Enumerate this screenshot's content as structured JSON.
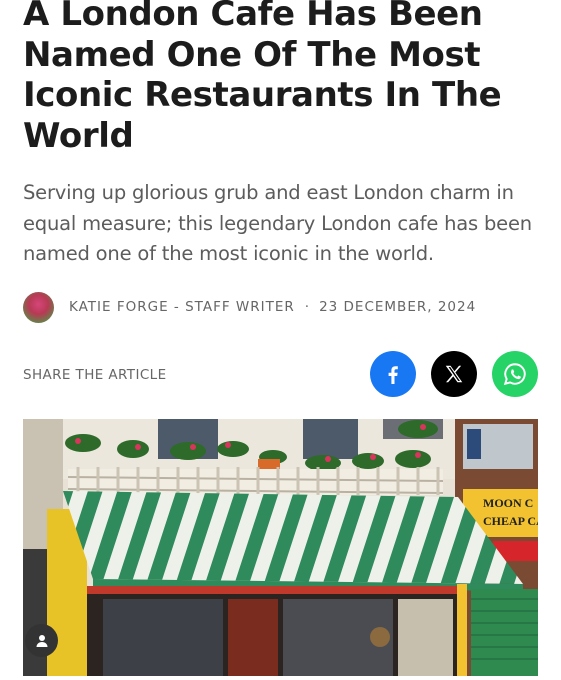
{
  "article": {
    "title": "A London Cafe Has Been Named One Of The Most Iconic Restaurants In The World",
    "subtitle": "Serving up glorious grub and east London charm in equal measure; this legendary London cafe has been named one of the most iconic in the world.",
    "author": "KATIE FORGE - STAFF WRITER",
    "separator": "·",
    "date": "23 DECEMBER, 2024"
  },
  "share": {
    "label": "SHARE THE ARTICLE",
    "buttons": [
      {
        "name": "facebook",
        "icon": "facebook-icon",
        "color": "#1877f2"
      },
      {
        "name": "x",
        "icon": "x-icon",
        "color": "#000000"
      },
      {
        "name": "whatsapp",
        "icon": "whatsapp-icon",
        "color": "#25d366"
      }
    ]
  },
  "hero_image": {
    "sign_line1": "MOON C",
    "sign_line2": "CHEAP CA"
  }
}
